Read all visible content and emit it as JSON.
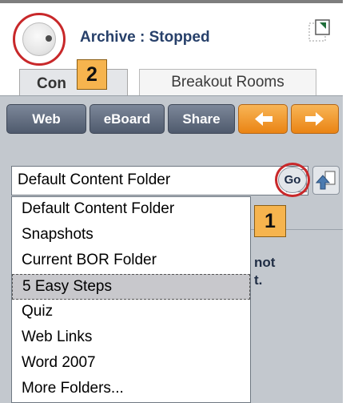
{
  "header": {
    "archive_status": "Archive : Stopped"
  },
  "tabs": [
    {
      "label": "Con",
      "hidden_label": "Content",
      "active": true
    },
    {
      "label": "Breakout Rooms",
      "active": false
    }
  ],
  "toolbar": {
    "web_label": "Web",
    "eboard_label": "eBoard",
    "share_label": "Share",
    "back_icon": "left-arrow-icon",
    "forward_icon": "right-arrow-icon"
  },
  "folder_select": {
    "value": "Default Content Folder",
    "go_label": "Go",
    "upload_icon": "upload-icon"
  },
  "dropdown": {
    "items": [
      {
        "label": "Default Content Folder",
        "selected": false
      },
      {
        "label": "Snapshots",
        "selected": false
      },
      {
        "label": "Current BOR Folder",
        "selected": false
      },
      {
        "label": "5 Easy Steps",
        "selected": true
      },
      {
        "label": "Quiz",
        "selected": false
      },
      {
        "label": "Web Links",
        "selected": false
      },
      {
        "label": "Word 2007",
        "selected": false
      },
      {
        "label": "More Folders...",
        "selected": false
      }
    ]
  },
  "callouts": {
    "one": "1",
    "two": "2"
  },
  "background_text": {
    "line1": "not",
    "line2": "t."
  },
  "colors": {
    "callout_fill": "#f6b44e",
    "highlight_ring": "#c8282a",
    "toolbar_gray": "#5f697c",
    "toolbar_orange": "#ea8414",
    "panel_bg": "#c3c8ce"
  }
}
